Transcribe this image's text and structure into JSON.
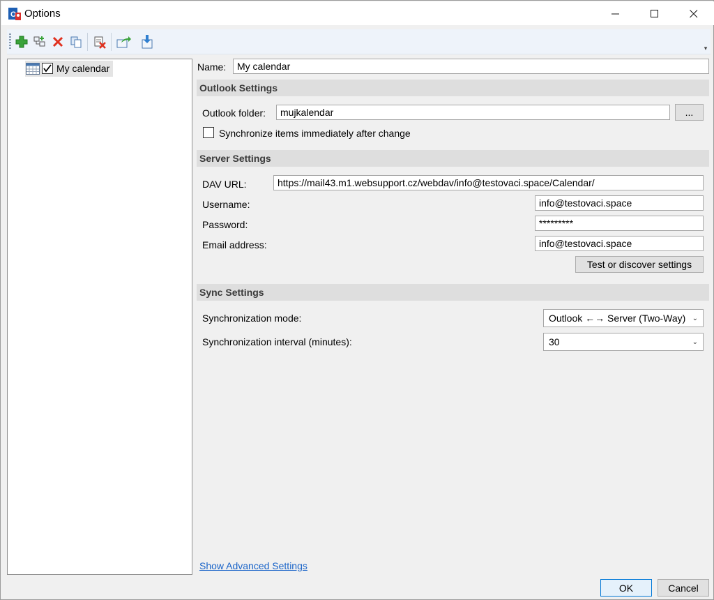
{
  "window": {
    "title": "Options"
  },
  "titlebar": {
    "minimize_glyph": "—",
    "maximize_glyph": "☐",
    "close_glyph": "✕"
  },
  "toolbar": {
    "icons": [
      "add-icon",
      "copy-structure-icon",
      "delete-icon",
      "copy-icon",
      "clear-cache-icon",
      "export-icon",
      "import-icon"
    ],
    "overflow_glyph": "▾"
  },
  "tree": {
    "items": [
      {
        "label": "My calendar",
        "checked": true,
        "icon": "calendar-icon"
      }
    ]
  },
  "form": {
    "name_label": "Name:",
    "name_value": "My calendar",
    "outlook_section": "Outlook Settings",
    "outlook_folder_label": "Outlook folder:",
    "outlook_folder_value": "mujkalendar",
    "browse_button": "...",
    "sync_immediately_label": "Synchronize items immediately after change",
    "sync_immediately_checked": false,
    "server_section": "Server Settings",
    "dav_url_label": "DAV URL:",
    "dav_url_value": "https://mail43.m1.websupport.cz/webdav/info@testovaci.space/Calendar/",
    "username_label": "Username:",
    "username_value": "info@testovaci.space",
    "password_label": "Password:",
    "password_value": "*********",
    "email_label": "Email address:",
    "email_value": "info@testovaci.space",
    "test_button": "Test or discover settings",
    "sync_section": "Sync Settings",
    "sync_mode_label": "Synchronization mode:",
    "sync_mode_value": "Outlook ←→ Server (Two-Way)",
    "sync_interval_label": "Synchronization interval (minutes):",
    "sync_interval_value": "30"
  },
  "footer": {
    "advanced_link": "Show Advanced Settings",
    "ok_button": "OK",
    "cancel_button": "Cancel"
  },
  "colors": {
    "accent": "#0078d7",
    "link": "#1a64c8",
    "section_bg": "#dedede",
    "toolbar_bg": "#eef3fa"
  }
}
